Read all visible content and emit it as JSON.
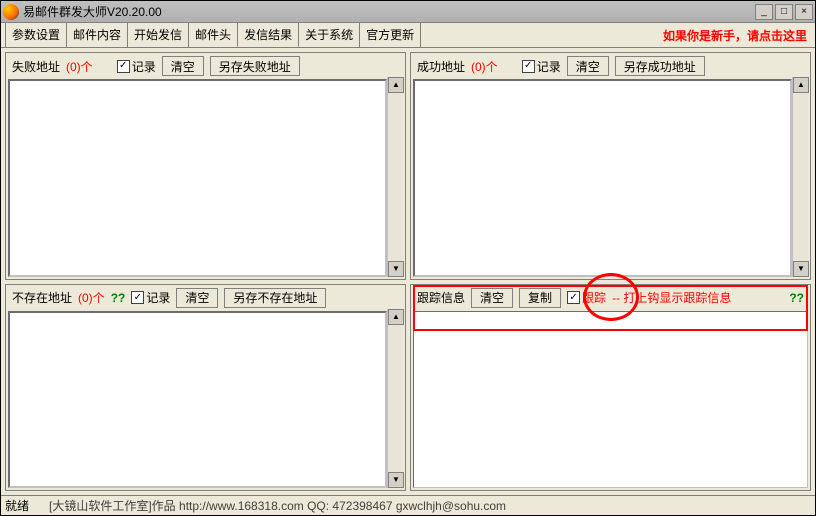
{
  "window": {
    "title": "易邮件群发大师V20.20.00",
    "icon_glyph": "✉"
  },
  "tabs": {
    "items": [
      "参数设置",
      "邮件内容",
      "开始发信",
      "邮件头",
      "发信结果",
      "关于系统",
      "官方更新"
    ],
    "active_index": 4
  },
  "novice_link": "如果你是新手，请点击这里",
  "panes": {
    "fail": {
      "label": "失败地址",
      "count": "(0)个",
      "record": "记录",
      "clear": "清空",
      "saveas": "另存失败地址"
    },
    "success": {
      "label": "成功地址",
      "count": "(0)个",
      "record": "记录",
      "clear": "清空",
      "saveas": "另存成功地址"
    },
    "notexist": {
      "label": "不存在地址",
      "count": "(0)个",
      "qq": "??",
      "record": "记录",
      "clear": "清空",
      "saveas": "另存不存在地址"
    },
    "trace": {
      "label": "跟踪信息",
      "clear": "清空",
      "copy": "复制",
      "track": "跟踪",
      "hint": "-- 打上钩显示跟踪信息",
      "qq": "??"
    }
  },
  "checkbox_check": "✓",
  "status": {
    "ready": "就绪",
    "credit": "[大镜山软件工作室]作品 http://www.168318.com QQ: 472398467 gxwclhjh@sohu.com"
  }
}
